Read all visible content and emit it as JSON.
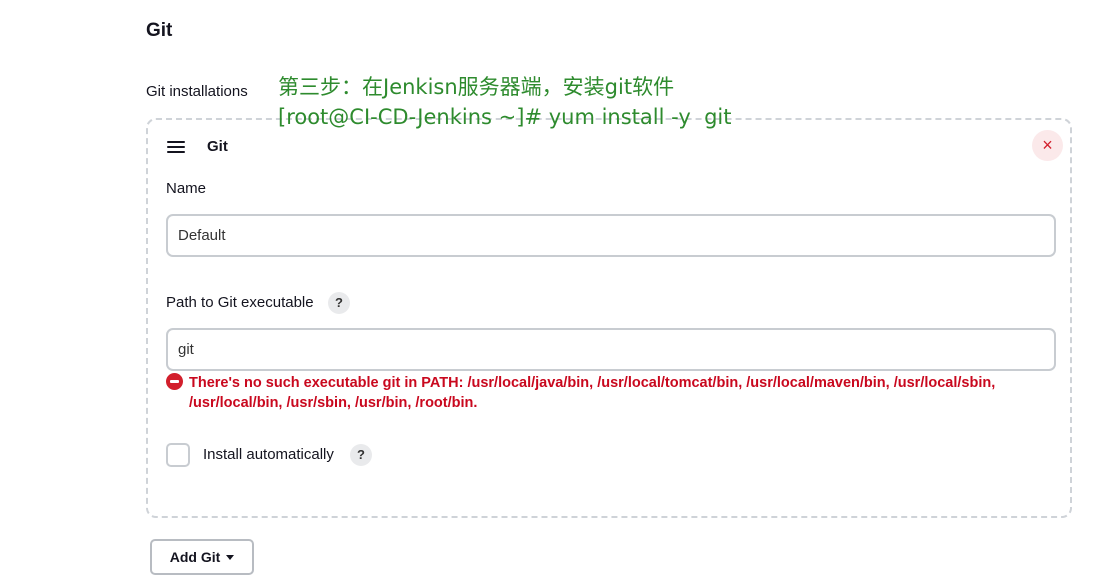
{
  "section": {
    "title": "Git"
  },
  "installations": {
    "label": "Git installations"
  },
  "annotation": {
    "line1": "第三步：在Jenkisn服务器端，安装git软件",
    "line2": "[root@CI-CD-Jenkins ~]# yum install -y  git"
  },
  "panel": {
    "title": "Git",
    "close_label": "×",
    "name": {
      "label": "Name",
      "value": "Default"
    },
    "path": {
      "label": "Path to Git executable",
      "help": "?",
      "value": "git",
      "error": "There's no such executable git in PATH: /usr/local/java/bin, /usr/local/tomcat/bin, /usr/local/maven/bin, /usr/local/sbin, /usr/local/bin, /usr/sbin, /usr/bin, /root/bin."
    },
    "install_auto": {
      "label": "Install automatically",
      "help": "?",
      "checked": false
    }
  },
  "add_button": {
    "label": "Add Git"
  },
  "colors": {
    "error": "#c9081e",
    "annotation": "#2e8b2e",
    "close": "#d21f2c"
  },
  "icons": {
    "handle": "drag-handle-icon",
    "close": "close-icon",
    "error": "error-icon",
    "caret": "caret-down-icon"
  }
}
